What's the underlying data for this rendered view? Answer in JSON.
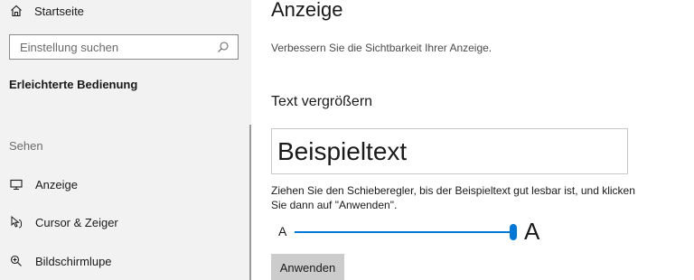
{
  "sidebar": {
    "home": {
      "label": "Startseite",
      "icon": "home-icon"
    },
    "search": {
      "placeholder": "Einstellung suchen",
      "value": "",
      "icon": "search-icon"
    },
    "section_heading": "Erleichterte Bedienung",
    "group_label": "Sehen",
    "items": [
      {
        "label": "Anzeige",
        "icon": "display-icon"
      },
      {
        "label": "Cursor & Zeiger",
        "icon": "cursor-icon"
      },
      {
        "label": "Bildschirmlupe",
        "icon": "magnifier-icon"
      }
    ]
  },
  "main": {
    "title": "Anzeige",
    "subtitle": "Verbessern Sie die Sichtbarkeit Ihrer Anzeige.",
    "text_size": {
      "heading": "Text vergrößern",
      "preview": "Beispieltext",
      "instructions": "Ziehen Sie den Schieberegler, bis der Beispieltext gut lesbar ist, und klicken Sie dann auf \"Anwenden\".",
      "slider": {
        "min_label": "A",
        "max_label": "A",
        "value_fraction": 1.0
      },
      "apply_label": "Anwenden"
    }
  },
  "colors": {
    "accent": "#0078d7",
    "sidebar_bg": "#f2f2f2",
    "button_bg": "#cccccc"
  }
}
